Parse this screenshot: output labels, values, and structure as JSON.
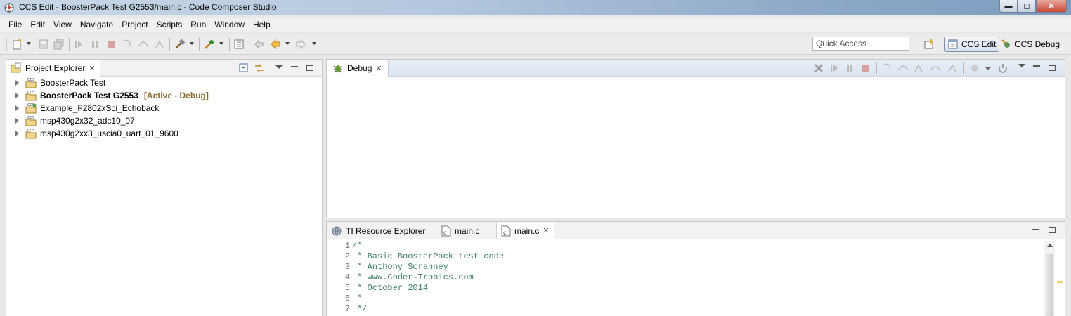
{
  "window": {
    "title": "CCS Edit - BoosterPack Test G2553/main.c - Code Composer Studio",
    "min_glyph": "▬",
    "max_glyph": "◻",
    "close_glyph": "✕"
  },
  "menu": [
    "File",
    "Edit",
    "View",
    "Navigate",
    "Project",
    "Scripts",
    "Run",
    "Window",
    "Help"
  ],
  "toolbar": {
    "quick_access_placeholder": "Quick Access",
    "perspectives": [
      {
        "label": "CCS Edit",
        "active": true
      },
      {
        "label": "CCS Debug",
        "active": false
      }
    ]
  },
  "project_explorer": {
    "tab_label": "Project Explorer",
    "close_glyph": "✕",
    "projects": [
      {
        "name": "BoosterPack Test",
        "bold": false,
        "tag": ""
      },
      {
        "name": "BoosterPack Test G2553",
        "bold": true,
        "tag": "[Active - Debug]"
      },
      {
        "name": "Example_F2802xSci_Echoback",
        "bold": false,
        "tag": ""
      },
      {
        "name": "msp430g2x32_adc10_07",
        "bold": false,
        "tag": ""
      },
      {
        "name": "msp430g2xx3_uscia0_uart_01_9600",
        "bold": false,
        "tag": ""
      }
    ]
  },
  "debug_view": {
    "tab_label": "Debug",
    "close_glyph": "✕"
  },
  "editor": {
    "tabs": [
      {
        "label": "TI Resource Explorer",
        "active": false
      },
      {
        "label": "main.c",
        "active": false
      },
      {
        "label": "main.c",
        "active": true
      }
    ],
    "close_glyph": "✕",
    "lines": [
      {
        "num": "1",
        "text": "/*"
      },
      {
        "num": "2",
        "text": " * Basic BoosterPack test code"
      },
      {
        "num": "3",
        "text": " * Anthony Scranney"
      },
      {
        "num": "4",
        "text": " * www.Coder-Tronics.com"
      },
      {
        "num": "5",
        "text": " * October 2014"
      },
      {
        "num": "6",
        "text": " *"
      },
      {
        "num": "7",
        "text": " */"
      }
    ]
  },
  "colors": {
    "comment": "#3f7f5f",
    "active_tag": "#8b6d2f"
  }
}
